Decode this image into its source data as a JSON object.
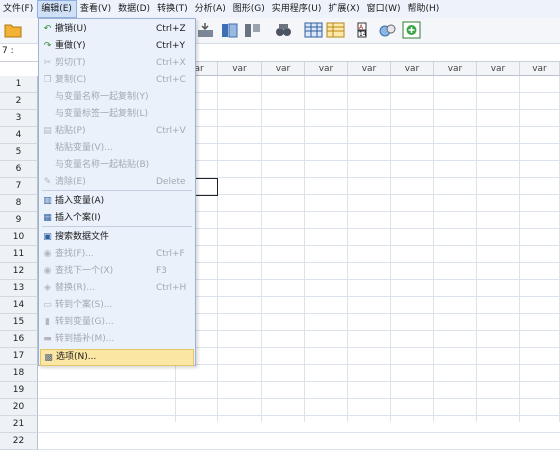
{
  "menubar": [
    "文件(F)",
    "编辑(E)",
    "查看(V)",
    "数据(D)",
    "转换(T)",
    "分析(A)",
    "图形(G)",
    "实用程序(U)",
    "扩展(X)",
    "窗口(W)",
    "帮助(H)"
  ],
  "active_menu": "编辑(E)",
  "cell_ref": "7 :",
  "column_header": "var",
  "rows": [
    "1",
    "2",
    "3",
    "4",
    "5",
    "6",
    "7",
    "8",
    "9",
    "10",
    "11",
    "12",
    "13",
    "14",
    "15",
    "16",
    "17",
    "18",
    "19",
    "20",
    "21",
    "22"
  ],
  "edit_menu": {
    "items": [
      {
        "label": "撤销(U)",
        "shortcut": "Ctrl+Z",
        "enabled": true,
        "icon": "undo-icon"
      },
      {
        "label": "重做(Y)",
        "shortcut": "Ctrl+Y",
        "enabled": true,
        "icon": "redo-icon"
      },
      {
        "label": "剪切(T)",
        "shortcut": "Ctrl+X",
        "enabled": false,
        "icon": "cut-icon"
      },
      {
        "label": "复制(C)",
        "shortcut": "Ctrl+C",
        "enabled": false,
        "icon": "copy-icon"
      },
      {
        "label": "与变量名称一起复制(Y)",
        "shortcut": "",
        "enabled": false,
        "icon": ""
      },
      {
        "label": "与变量标签一起复制(L)",
        "shortcut": "",
        "enabled": false,
        "icon": ""
      },
      {
        "label": "粘贴(P)",
        "shortcut": "Ctrl+V",
        "enabled": false,
        "icon": "paste-icon"
      },
      {
        "label": "粘贴变量(V)...",
        "shortcut": "",
        "enabled": false,
        "icon": ""
      },
      {
        "label": "与变量名称一起粘贴(B)",
        "shortcut": "",
        "enabled": false,
        "icon": ""
      },
      {
        "label": "清除(E)",
        "shortcut": "Delete",
        "enabled": false,
        "icon": "eraser-icon"
      },
      {
        "label": "插入变量(A)",
        "shortcut": "",
        "enabled": true,
        "icon": "insert-variable-icon"
      },
      {
        "label": "插入个案(I)",
        "shortcut": "",
        "enabled": true,
        "icon": "insert-case-icon"
      },
      {
        "label": "搜索数据文件",
        "shortcut": "",
        "enabled": true,
        "icon": "search-file-icon"
      },
      {
        "label": "查找(F)...",
        "shortcut": "Ctrl+F",
        "enabled": false,
        "icon": "binoculars-icon"
      },
      {
        "label": "查找下一个(X)",
        "shortcut": "F3",
        "enabled": false,
        "icon": "find-next-icon"
      },
      {
        "label": "替换(R)...",
        "shortcut": "Ctrl+H",
        "enabled": false,
        "icon": "replace-icon"
      },
      {
        "label": "转到个案(S)...",
        "shortcut": "",
        "enabled": false,
        "icon": "goto-case-icon"
      },
      {
        "label": "转到变量(G)...",
        "shortcut": "",
        "enabled": false,
        "icon": "goto-variable-icon"
      },
      {
        "label": "转到插补(M)...",
        "shortcut": "",
        "enabled": false,
        "icon": "goto-imputation-icon"
      },
      {
        "label": "选项(N)...",
        "shortcut": "",
        "enabled": true,
        "icon": "options-icon",
        "highlighted": true
      }
    ]
  }
}
